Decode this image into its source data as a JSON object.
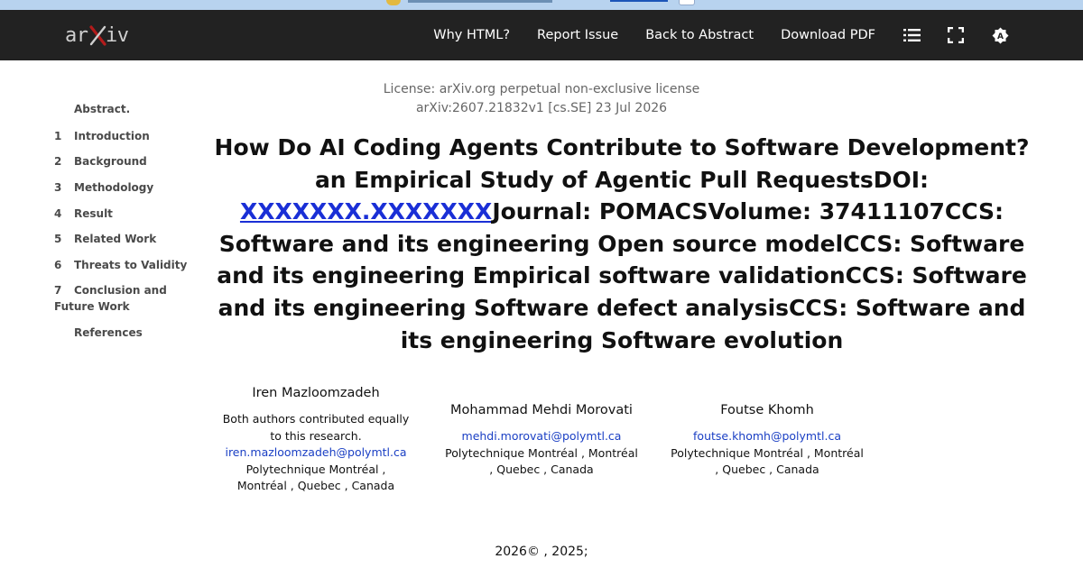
{
  "nav": {
    "logo_text": "arXiv",
    "links": [
      "Why HTML?",
      "Report Issue",
      "Back to Abstract",
      "Download PDF"
    ],
    "icons": [
      "list-icon",
      "fullscreen-icon",
      "settings-icon"
    ]
  },
  "toc": [
    {
      "num": "",
      "label": "Abstract."
    },
    {
      "num": "1",
      "label": "Introduction"
    },
    {
      "num": "2",
      "label": "Background"
    },
    {
      "num": "3",
      "label": "Methodology"
    },
    {
      "num": "4",
      "label": "Result"
    },
    {
      "num": "5",
      "label": "Related Work"
    },
    {
      "num": "6",
      "label": "Threats to Validity"
    },
    {
      "num": "7",
      "label": "Conclusion and Future Work"
    },
    {
      "num": "",
      "label": "References"
    }
  ],
  "paper": {
    "license": "License: arXiv.org perpetual non-exclusive license",
    "arxiv_id": "arXiv:2607.21832v1 [cs.SE] 23 Jul 2026",
    "title_part1": "How Do AI Coding Agents Contribute to Software Development? an Empirical Study of Agentic Pull RequestsDOI: ",
    "doi_link": "XXXXXXX.XXXXXXX",
    "title_part2": "Journal: POMACSVolume: 37411107CCS: Software and its engineering Open source modelCCS: Software and its engineering Empirical software validationCCS: Software and its engineering Software defect analysisCCS: Software and its engineering Software evolution",
    "copyright": "2026© , 2025;"
  },
  "authors": [
    {
      "name": "Iren Mazloomzadeh",
      "note": "Both authors contributed equally to this research.",
      "email": "iren.mazloomzadeh@polymtl.ca",
      "affiliation": "Polytechnique Montréal   , Montréal , Quebec ,   Canada"
    },
    {
      "name": "Mohammad Mehdi Morovati",
      "note": "",
      "email": "mehdi.morovati@polymtl.ca",
      "affiliation": "Polytechnique Montréal   , Montréal , Quebec ,   Canada"
    },
    {
      "name": "Foutse Khomh",
      "note": "",
      "email": "foutse.khomh@polymtl.ca",
      "affiliation": "Polytechnique Montréal   , Montréal , Quebec ,   Canada"
    }
  ]
}
